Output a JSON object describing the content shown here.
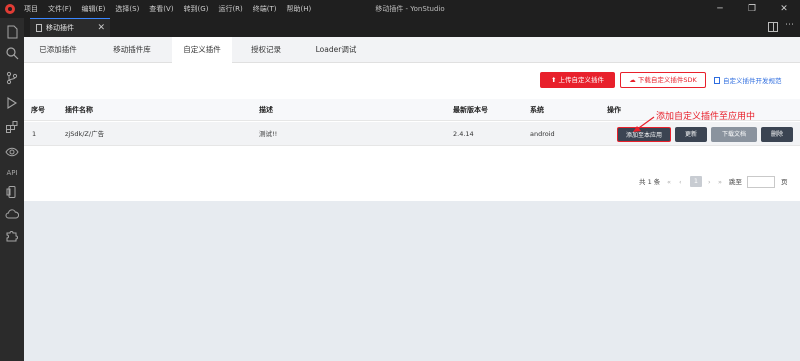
{
  "window": {
    "title": "移动插件 - YonStudio",
    "menu": [
      "项目",
      "文件(F)",
      "编辑(E)",
      "选择(S)",
      "查看(V)",
      "转到(G)",
      "运行(R)",
      "终端(T)",
      "帮助(H)"
    ],
    "controls": [
      "─",
      "❐",
      "✕"
    ]
  },
  "activitybar": {
    "api_label": "API"
  },
  "editor_tab": {
    "label": "移动插件",
    "close": "✕"
  },
  "subtabs": [
    "已添加插件",
    "移动插件库",
    "自定义插件",
    "授权记录",
    "Loader调试"
  ],
  "toolbar": {
    "upload_label": "上传自定义插件",
    "download_label": "下载自定义插件SDK",
    "dev_doc_label": "自定义插件开发规范"
  },
  "table": {
    "headers": [
      "序号",
      "插件名称",
      "描述",
      "最新版本号",
      "系统",
      "操作"
    ],
    "rows": [
      {
        "index": "1",
        "name": "zjSdk/Z/广告",
        "description": "测试!!",
        "version": "2.4.14",
        "system": "android",
        "actions": [
          "添加至本应用",
          "更新",
          "下载文档",
          "删除"
        ]
      }
    ]
  },
  "annotation": {
    "text": "添加自定义插件至应用中",
    "color": "#e8202b"
  },
  "pagination": {
    "total": "共 1 条",
    "prev": "«",
    "prev_one": "‹",
    "current": "1",
    "next_one": "›",
    "next": "»",
    "goto_label": "跳至",
    "page_unit": "页"
  },
  "colors": {
    "accent": "#e8202b",
    "dark_button": "#3b4452",
    "disabled_button": "#8a939e",
    "link": "#2d6cdf"
  }
}
